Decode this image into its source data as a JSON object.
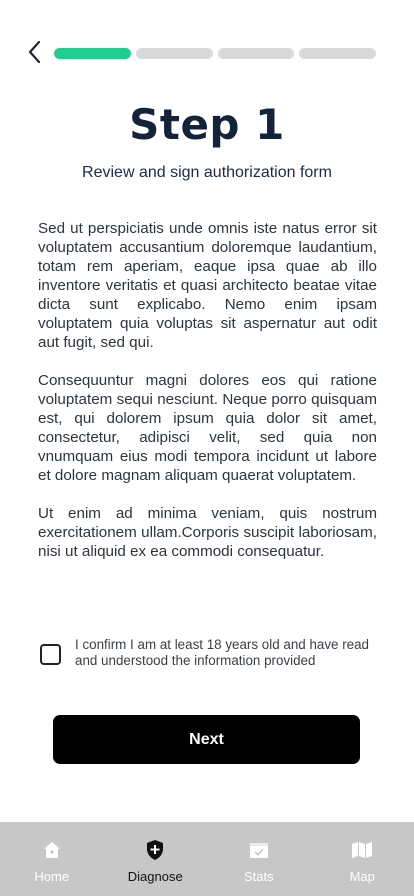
{
  "header": {
    "back_icon": "chevron-left-icon",
    "progress": {
      "total_steps": 4,
      "current_step": 1
    }
  },
  "step": {
    "title": "Step 1",
    "subtitle": "Review and sign authorization form"
  },
  "content": {
    "paragraphs": [
      "Sed ut perspiciatis unde omnis iste natus error sit voluptatem accusantium doloremque laudantium, totam rem aperiam, eaque ipsa quae ab illo inventore veritatis et quasi architecto beatae vitae dicta sunt explicabo. Nemo enim ipsam voluptatem quia voluptas sit aspernatur aut odit aut fugit, sed qui.",
      "Consequuntur magni dolores eos qui ratione voluptatem sequi nesciunt. Neque porro quisquam est, qui dolorem ipsum quia dolor sit amet, consectetur, adipisci velit, sed quia non vnumquam eius modi tempora incidunt ut labore et dolore magnam aliquam quaerat voluptatem.",
      "Ut enim ad minima veniam, quis nostrum exercitationem ullam.Corporis suscipit laboriosam, nisi ut aliquid ex ea commodi consequatur."
    ]
  },
  "confirm": {
    "checked": false,
    "label": "I confirm I am at least 18 years old and have read and understood the information provided"
  },
  "actions": {
    "next_label": "Next"
  },
  "tabbar": {
    "items": [
      {
        "label": "Home",
        "icon": "home-icon",
        "active": false
      },
      {
        "label": "Diagnose",
        "icon": "shield-plus-icon",
        "active": true
      },
      {
        "label": "Stats",
        "icon": "calendar-check-icon",
        "active": false
      },
      {
        "label": "Map",
        "icon": "map-icon",
        "active": false
      }
    ]
  },
  "colors": {
    "progress_active": "#1fce8e",
    "progress_inactive": "#d9d9d9",
    "tabbar_bg": "#c7c7c7",
    "button_bg": "#000000"
  }
}
